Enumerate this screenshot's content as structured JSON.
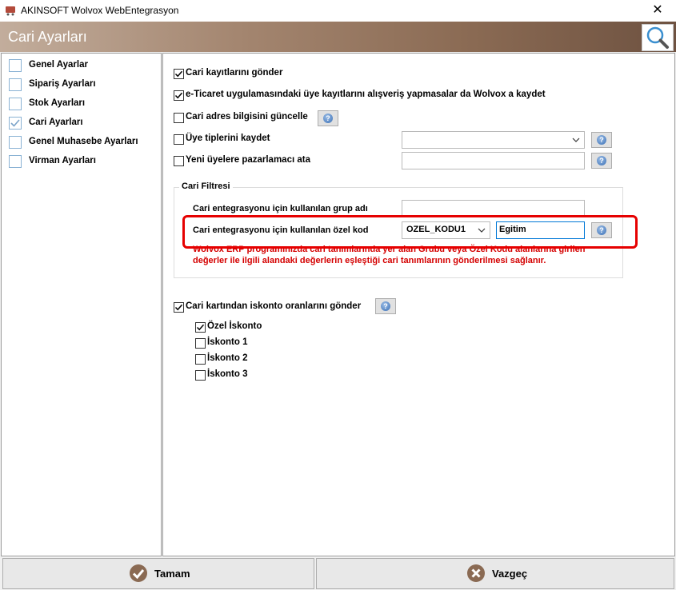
{
  "window": {
    "title": "AKINSOFT Wolvox WebEntegrasyon",
    "close_glyph": "✕"
  },
  "header": {
    "title": "Cari Ayarları",
    "search_icon": "search-icon"
  },
  "sidebar": {
    "items": [
      {
        "label": "Genel Ayarlar",
        "checked": false
      },
      {
        "label": "Sipariş Ayarları",
        "checked": false
      },
      {
        "label": "Stok Ayarları",
        "checked": false
      },
      {
        "label": "Cari Ayarları",
        "checked": true
      },
      {
        "label": "Genel Muhasebe Ayarları",
        "checked": false
      },
      {
        "label": "Virman Ayarları",
        "checked": false
      }
    ]
  },
  "main": {
    "send_accounts": {
      "label": "Cari kayıtlarını gönder",
      "checked": true
    },
    "save_members": {
      "label": "e-Ticaret uygulamasındaki üye kayıtlarını alışveriş yapmasalar da Wolvox a kaydet",
      "checked": true
    },
    "update_address": {
      "label": "Cari adres bilgisini güncelle",
      "checked": false
    },
    "save_member_types": {
      "label": "Üye tiplerini kaydet",
      "checked": false,
      "select_value": ""
    },
    "assign_marketer": {
      "label": "Yeni üyelere pazarlamacı ata",
      "checked": false,
      "input_value": ""
    },
    "filter": {
      "title": "Cari Filtresi",
      "group_name_label": "Cari entegrasyonu için kullanılan grup adı",
      "group_name_value": "",
      "special_code_label": "Cari entegrasyonu için kullanılan özel kod",
      "special_code_select": "OZEL_KODU1",
      "special_code_value": "Egitim",
      "info_line1": "Wolvox ERP programınızda cari tanımlarında yer alan Grubu veya Özel Kodu alanlarına girilen",
      "info_line2": "değerler ile ilgili alandaki değerlerin eşleştiği cari tanımlarının gönderilmesi sağlanır."
    },
    "discount": {
      "label": "Cari kartından iskonto oranlarını gönder",
      "checked": true
    },
    "discount_items": [
      {
        "label": "Özel İskonto",
        "checked": true
      },
      {
        "label": "İskonto 1",
        "checked": false
      },
      {
        "label": "İskonto 2",
        "checked": false
      },
      {
        "label": "İskonto 3",
        "checked": false
      }
    ]
  },
  "footer": {
    "ok_label": "Tamam",
    "cancel_label": "Vazgeç"
  },
  "colors": {
    "highlight": "#e60000",
    "info_text": "#d40000",
    "header_start": "#c2ad9c",
    "header_end": "#6e5241"
  }
}
